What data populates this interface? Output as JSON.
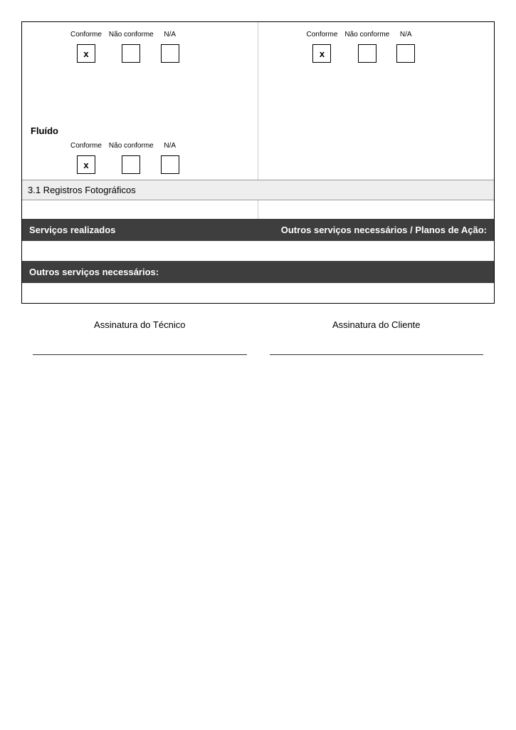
{
  "checkLabels": {
    "conforme": "Conforme",
    "naoConforme": "Não conforme",
    "na": "N/A"
  },
  "checkMarks": {
    "row1_left": {
      "conforme": "x",
      "naoConforme": "",
      "na": ""
    },
    "row1_right": {
      "conforme": "x",
      "naoConforme": "",
      "na": ""
    },
    "row2_left": {
      "conforme": "x",
      "naoConforme": "",
      "na": ""
    }
  },
  "sections": {
    "fluido": "Fluído",
    "registros": "3.1 Registros Fotográficos",
    "servicosRealizados": "Serviços realizados",
    "outrosPlanos": "Outros serviços necessários / Planos de Ação:",
    "outrosNecessarios": "Outros serviços necessários:"
  },
  "signatures": {
    "tecnico": "Assinatura do Técnico",
    "cliente": "Assinatura do Cliente"
  }
}
